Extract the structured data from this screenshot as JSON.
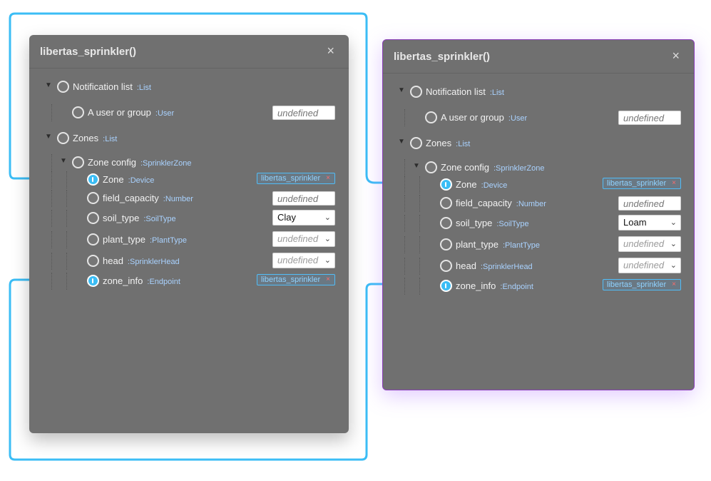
{
  "colors": {
    "node_bg": "#707070",
    "wire": "#3bbdf5",
    "selected_border": "#8a3fb8",
    "type_label": "#a9d2ff",
    "chip_remove": "#ff6b6b"
  },
  "nodes": [
    {
      "title": "libertas_sprinkler()",
      "close": "×",
      "notification": {
        "label": "Notification list",
        "type": ":List"
      },
      "user": {
        "label": "A user or group",
        "type": ":User",
        "placeholder": "undefined"
      },
      "zones": {
        "label": "Zones",
        "type": ":List"
      },
      "zone_config": {
        "label": "Zone config",
        "type": ":SprinklerZone"
      },
      "zone": {
        "label": "Zone",
        "type": ":Device",
        "value": "libertas_sprinkler",
        "remove": "×"
      },
      "field_capacity": {
        "label": "field_capacity",
        "type": ":Number",
        "placeholder": "undefined"
      },
      "soil_type": {
        "label": "soil_type",
        "type": ":SoilType",
        "value": "Clay"
      },
      "plant_type": {
        "label": "plant_type",
        "type": ":PlantType",
        "value": "undefined"
      },
      "head": {
        "label": "head",
        "type": ":SprinklerHead",
        "value": "undefined"
      },
      "zone_info": {
        "label": "zone_info",
        "type": ":Endpoint",
        "value": "libertas_sprinkler",
        "remove": "×"
      }
    },
    {
      "title": "libertas_sprinkler()",
      "close": "×",
      "notification": {
        "label": "Notification list",
        "type": ":List"
      },
      "user": {
        "label": "A user or group",
        "type": ":User",
        "placeholder": "undefined"
      },
      "zones": {
        "label": "Zones",
        "type": ":List"
      },
      "zone_config": {
        "label": "Zone config",
        "type": ":SprinklerZone"
      },
      "zone": {
        "label": "Zone",
        "type": ":Device",
        "value": "libertas_sprinkler",
        "remove": "×"
      },
      "field_capacity": {
        "label": "field_capacity",
        "type": ":Number",
        "placeholder": "undefined"
      },
      "soil_type": {
        "label": "soil_type",
        "type": ":SoilType",
        "value": "Loam"
      },
      "plant_type": {
        "label": "plant_type",
        "type": ":PlantType",
        "value": "undefined"
      },
      "head": {
        "label": "head",
        "type": ":SprinklerHead",
        "value": "undefined"
      },
      "zone_info": {
        "label": "zone_info",
        "type": ":Endpoint",
        "value": "libertas_sprinkler",
        "remove": "×"
      }
    }
  ],
  "arrow_glyph": "▼",
  "select_chevron": "⌄"
}
